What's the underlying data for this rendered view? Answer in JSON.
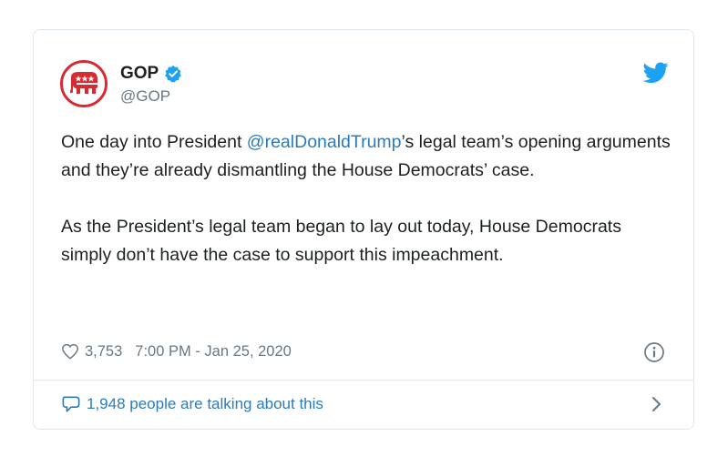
{
  "tweet": {
    "author": {
      "name": "GOP",
      "handle": "@GOP",
      "verified": true,
      "avatar_icon": "elephant-icon"
    },
    "body": {
      "p1_before": "One day into President ",
      "p1_mention": "@realDonaldTrump",
      "p1_after": "’s legal team’s opening arguments and they’re already dismantling the House Democrats’ case.",
      "p2": "As the President’s legal team began to lay out today, House Democrats simply don’t have the case to support this impeachment."
    },
    "likes": "3,753",
    "timestamp": "7:00 PM - Jan 25, 2020",
    "footer_text": "1,948 people are talking about this"
  },
  "colors": {
    "link": "#2b7bb9",
    "muted": "#697882",
    "twitter_blue": "#1da1f2",
    "gop_red": "#d62b32",
    "border": "#e1e8ed"
  },
  "icons": [
    "elephant-icon",
    "verified-badge-icon",
    "twitter-bird-icon",
    "heart-icon",
    "info-icon",
    "speech-bubble-icon",
    "chevron-right-icon"
  ]
}
